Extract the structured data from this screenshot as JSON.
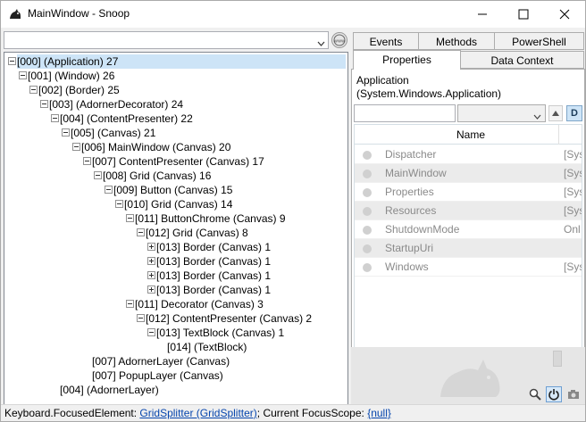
{
  "window": {
    "title": "MainWindow - Snoop"
  },
  "tree": {
    "nodes": [
      {
        "label": "[000]  (Application) 27",
        "toggle": "minus",
        "selected": true
      },
      {
        "label": "[001]  (Window) 26",
        "toggle": "minus"
      },
      {
        "label": "[002]  (Border) 25",
        "toggle": "minus"
      },
      {
        "label": "[003]  (AdornerDecorator) 24",
        "toggle": "minus"
      },
      {
        "label": "[004]  (ContentPresenter) 22",
        "toggle": "minus"
      },
      {
        "label": "[005]  (Canvas) 21",
        "toggle": "minus"
      },
      {
        "label": "[006] MainWindow (Canvas) 20",
        "toggle": "minus"
      },
      {
        "label": "[007] ContentPresenter (Canvas) 17",
        "toggle": "minus"
      },
      {
        "label": "[008] Grid (Canvas) 16",
        "toggle": "minus"
      },
      {
        "label": "[009] Button (Canvas) 15",
        "toggle": "minus"
      },
      {
        "label": "[010] Grid (Canvas) 14",
        "toggle": "minus"
      },
      {
        "label": "[011] ButtonChrome (Canvas) 9",
        "toggle": "minus"
      },
      {
        "label": "[012] Grid (Canvas) 8",
        "toggle": "minus"
      },
      {
        "label": "[013] Border (Canvas) 1",
        "toggle": "plus"
      },
      {
        "label": "[013] Border (Canvas) 1",
        "toggle": "plus"
      },
      {
        "label": "[013] Border (Canvas) 1",
        "toggle": "plus"
      },
      {
        "label": "[013] Border (Canvas) 1",
        "toggle": "plus"
      },
      {
        "label": "[011] Decorator (Canvas) 3",
        "toggle": "minus"
      },
      {
        "label": "[012] ContentPresenter (Canvas) 2",
        "toggle": "minus"
      },
      {
        "label": "[013] TextBlock (Canvas) 1",
        "toggle": "minus"
      },
      {
        "label": "[014]  (TextBlock)",
        "toggle": "none"
      },
      {
        "label": "[007] AdornerLayer (Canvas)",
        "toggle": "none"
      },
      {
        "label": "[007] PopupLayer (Canvas)",
        "toggle": "none"
      },
      {
        "label": "[004]  (AdornerLayer)",
        "toggle": "none"
      }
    ]
  },
  "tabs_row1": [
    "Events",
    "Methods",
    "PowerShell"
  ],
  "tabs_row2": [
    "Properties",
    "Data Context"
  ],
  "properties": {
    "object_name_line1": "Application",
    "object_name_line2": "(System.Windows.Application)",
    "filter_placeholder": "",
    "filter_combo_value": "",
    "defaults_button": "D",
    "column_name": "Name",
    "rows": [
      {
        "name": "Dispatcher",
        "value": "[Sys"
      },
      {
        "name": "MainWindow",
        "value": "[Sys"
      },
      {
        "name": "Properties",
        "value": "[Sys"
      },
      {
        "name": "Resources",
        "value": "[Sys"
      },
      {
        "name": "ShutdownMode",
        "value": "Onl"
      },
      {
        "name": "StartupUri",
        "value": ""
      },
      {
        "name": "Windows",
        "value": "[Sys"
      }
    ]
  },
  "status": {
    "prefix": "Keyboard.FocusedElement: ",
    "focused_element": "GridSplitter (GridSplitter)",
    "middle": "; Current FocusScope: ",
    "focus_scope": "{null}"
  },
  "icons": {
    "app_icon": "snoop-cat-icon",
    "web_button": "www-icon",
    "magnify": "magnify-icon",
    "power": "power-icon",
    "camera": "camera-icon"
  },
  "colors": {
    "selection": "#cde4f7",
    "link": "#0645ad"
  }
}
